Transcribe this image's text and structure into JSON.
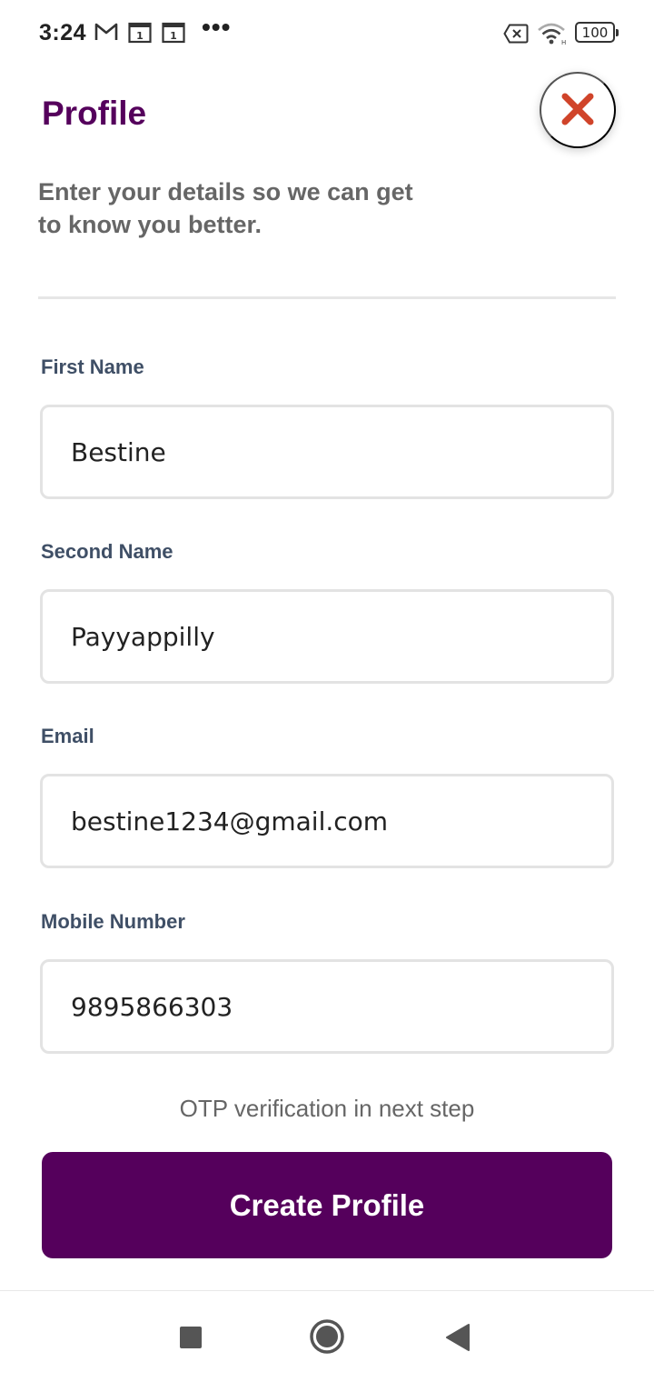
{
  "status_bar": {
    "time": "3:24",
    "more": "•••",
    "battery": "100",
    "icons": [
      "gmail-icon",
      "calendar-icon",
      "calendar-icon",
      "sim-off-icon",
      "wifi-icon",
      "battery-icon"
    ]
  },
  "header": {
    "title": "Profile",
    "close_icon": "close-icon"
  },
  "intro": {
    "text": "Enter your details so we can get to know you better."
  },
  "form": {
    "first_name": {
      "label": "First Name",
      "value": "Bestine"
    },
    "second_name": {
      "label": "Second Name",
      "value": "Payyappilly"
    },
    "email": {
      "label": "Email",
      "value": "bestine1234@gmail.com"
    },
    "mobile": {
      "label": "Mobile Number",
      "value": "9895866303"
    }
  },
  "otp_note": "OTP verification in next step",
  "submit": {
    "label": "Create Profile"
  },
  "nav": {
    "icons": [
      "recent-apps-icon",
      "home-icon",
      "back-icon"
    ]
  },
  "colors": {
    "brand": "#55005c",
    "close_accent": "#d0442a",
    "label": "#3f4f66",
    "muted": "#666666"
  }
}
